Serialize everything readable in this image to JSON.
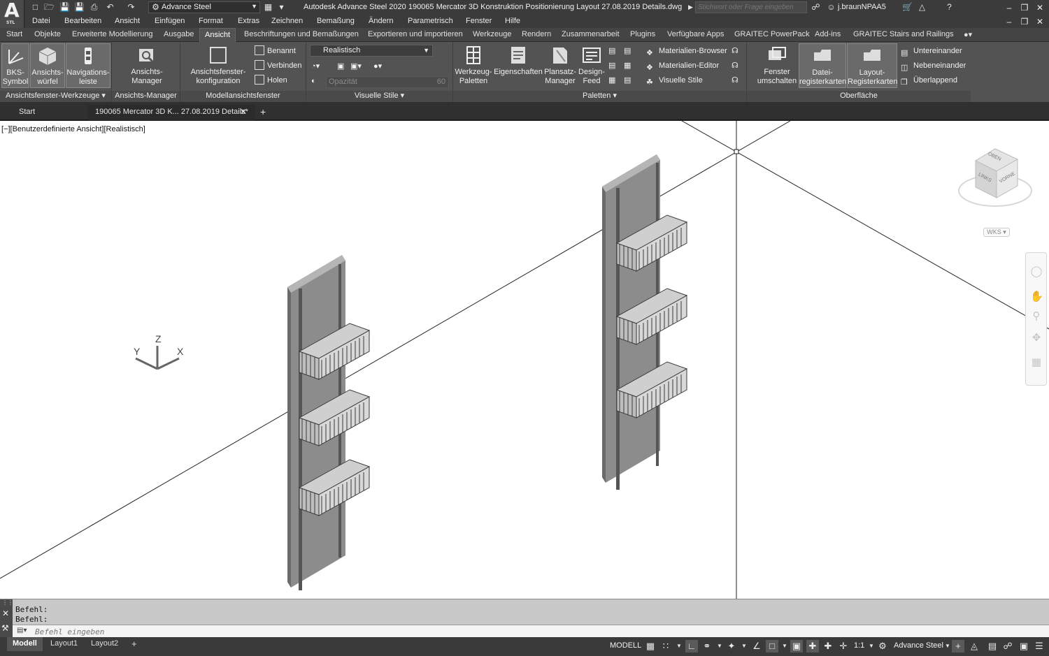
{
  "titlebar": {
    "logo_letter": "A",
    "logo_sub": "STL",
    "workspace": "Advance Steel",
    "title": "Autodesk Advance Steel 2020    190065 Mercator 3D Konstruktion Positionierung Layout  27.08.2019 Details.dwg",
    "search_placeholder": "Stichwort oder Frage eingeben",
    "user": "j.braunNPAA5"
  },
  "menubar": [
    "Datei",
    "Bearbeiten",
    "Ansicht",
    "Einfügen",
    "Format",
    "Extras",
    "Zeichnen",
    "Bemaßung",
    "Ändern",
    "Parametrisch",
    "Fenster",
    "Hilfe"
  ],
  "ribbon_tabs": [
    "Start",
    "Objekte",
    "Erweiterte Modellierung",
    "Ausgabe",
    "Ansicht",
    "Beschriftungen und Bemaßungen",
    "Exportieren und importieren",
    "Werkzeuge",
    "Rendern",
    "Zusammenarbeit",
    "Plugins",
    "Verfügbare Apps",
    "GRAITEC PowerPack",
    "Add-ins",
    "GRAITEC Stairs and Railings"
  ],
  "ribbon": {
    "panels": {
      "ansichtsfenster_werkzeuge": "Ansichtsfenster-Werkzeuge",
      "ansichts_manager": "Ansichts-Manager",
      "modellansichtsfenster": "Modellansichtsfenster",
      "visuelle_stile": "Visuelle Stile",
      "paletten": "Paletten",
      "oberflaeche": "Oberfläche"
    },
    "buttons": {
      "bks_symbol": [
        "BKS-",
        "Symbol"
      ],
      "ansichtswuerfel": [
        "Ansichts-",
        "würfel"
      ],
      "navigationsleiste": [
        "Navigations-",
        "leiste"
      ],
      "ansichts_manager": [
        "Ansichts-",
        "Manager"
      ],
      "ansichtsfenster_konfig": [
        "Ansichtsfenster-",
        "konfiguration"
      ],
      "benannt": "Benannt",
      "verbinden": "Verbinden",
      "holen": "Holen",
      "visual_style": "Realistisch",
      "opacity_label": "Opazität",
      "opacity_value": "60",
      "werkzeug_paletten": [
        "Werkzeug-",
        "Paletten"
      ],
      "eigenschaften": [
        "Eigenschaften",
        ""
      ],
      "plansatz_manager": [
        "Plansatz-",
        "Manager"
      ],
      "design_feed": [
        "Design-",
        "Feed"
      ],
      "materialien_browser": "Materialien-Browser",
      "materialien_editor": "Materialien-Editor",
      "visuelle_stile_btn": "Visuelle Stile",
      "fenster_umschalten": [
        "Fenster",
        "umschalten"
      ],
      "datei_registerkarten": [
        "Datei-",
        "registerkarten"
      ],
      "layout_registerkarten": [
        "Layout-",
        "Registerkarten"
      ],
      "untereinander": "Untereinander",
      "nebeneinander": "Nebeneinander",
      "ueberlappend": "Überlappend"
    }
  },
  "doc_tabs": {
    "start": "Start",
    "drawing": "190065 Mercator 3D K... 27.08.2019 Details*"
  },
  "viewport": {
    "label": "[−][Benutzerdefinierte Ansicht][Realistisch]",
    "viewcube": {
      "top": "OBEN",
      "left": "LINKS",
      "front": "VORNE"
    },
    "wks": "WKS",
    "ucs": {
      "x": "X",
      "y": "Y",
      "z": "Z"
    }
  },
  "command": {
    "history": [
      "Befehl:",
      "Befehl:"
    ],
    "placeholder": "Befehl eingeben"
  },
  "layout_tabs": [
    "Modell",
    "Layout1",
    "Layout2"
  ],
  "status": {
    "model": "MODELL",
    "scale": "1:1",
    "workspace": "Advance Steel"
  }
}
